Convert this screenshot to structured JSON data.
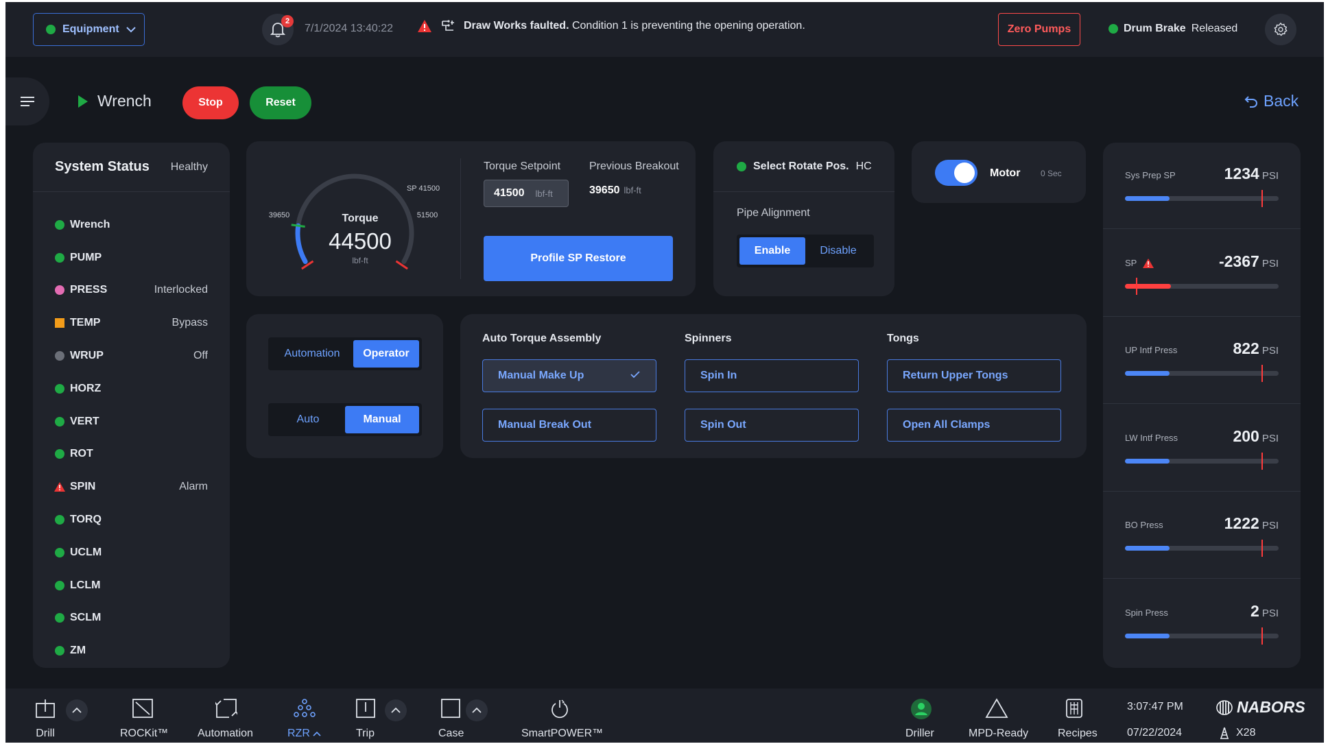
{
  "topbar": {
    "equipment_label": "Equipment",
    "notifications_count": "2",
    "datetime": "7/1/2024  13:40:22",
    "fault_bold": "Draw Works faulted.",
    "fault_text": "Condition 1 is preventing the opening operation.",
    "zero_pumps": "Zero Pumps",
    "drum_brake_label": "Drum Brake",
    "drum_brake_state": "Released"
  },
  "header": {
    "title": "Wrench",
    "stop": "Stop",
    "reset": "Reset",
    "back": "Back"
  },
  "system_status": {
    "title": "System Status",
    "health": "Healthy",
    "items": [
      {
        "name": "Wrench",
        "status": "",
        "indicator": "green"
      },
      {
        "name": "PUMP",
        "status": "",
        "indicator": "green"
      },
      {
        "name": "PRESS",
        "status": "Interlocked",
        "indicator": "pink"
      },
      {
        "name": "TEMP",
        "status": "Bypass",
        "indicator": "orange"
      },
      {
        "name": "WRUP",
        "status": "Off",
        "indicator": "gray"
      },
      {
        "name": "HORZ",
        "status": "",
        "indicator": "green"
      },
      {
        "name": "VERT",
        "status": "",
        "indicator": "green"
      },
      {
        "name": "ROT",
        "status": "",
        "indicator": "green"
      },
      {
        "name": "SPIN",
        "status": "Alarm",
        "indicator": "alarm"
      },
      {
        "name": "TORQ",
        "status": "",
        "indicator": "green"
      },
      {
        "name": "UCLM",
        "status": "",
        "indicator": "green"
      },
      {
        "name": "LCLM",
        "status": "",
        "indicator": "green"
      },
      {
        "name": "SCLM",
        "status": "",
        "indicator": "green"
      },
      {
        "name": "ZM",
        "status": "",
        "indicator": "green"
      }
    ]
  },
  "torque": {
    "label": "Torque",
    "value": "44500",
    "unit": "lbf-ft",
    "gauge_min_label": "39650",
    "gauge_max_label": "51500",
    "gauge_sp_label": "SP 41500",
    "gauge_min": 39650,
    "gauge_max": 51500,
    "gauge_value": 44500,
    "setpoint_label": "Torque Setpoint",
    "setpoint_value": "41500",
    "setpoint_unit": "lbf-ft",
    "prev_label": "Previous Breakout",
    "prev_value": "39650",
    "prev_unit": "lbf-ft",
    "profile_button": "Profile SP Restore"
  },
  "rotate": {
    "select_label": "Select Rotate Pos.",
    "select_value": "HC",
    "pipe_label": "Pipe Alignment",
    "enable": "Enable",
    "disable": "Disable"
  },
  "motor": {
    "label": "Motor",
    "seconds": "0 Sec",
    "on": true
  },
  "mode": {
    "automation": "Automation",
    "operator": "Operator",
    "auto": "Auto",
    "manual": "Manual"
  },
  "auto_torque": {
    "col1_title": "Auto Torque Assembly",
    "col2_title": "Spinners",
    "col3_title": "Tongs",
    "manual_make_up": "Manual Make Up",
    "manual_break_out": "Manual Break Out",
    "spin_in": "Spin In",
    "spin_out": "Spin Out",
    "return_upper_tongs": "Return Upper Tongs",
    "open_all_clamps": "Open All Clamps"
  },
  "pressures": [
    {
      "label": "Sys Prep SP",
      "value": "1234",
      "unit": "PSI",
      "fill": 0.29,
      "mark": 0.89,
      "alarm": false
    },
    {
      "label": "SP",
      "value": "-2367",
      "unit": "PSI",
      "fill": 0.3,
      "mark": 0.07,
      "alarm": true
    },
    {
      "label": "UP Intf Press",
      "value": "822",
      "unit": "PSI",
      "fill": 0.29,
      "mark": 0.89,
      "alarm": false
    },
    {
      "label": "LW Intf Press",
      "value": "200",
      "unit": "PSI",
      "fill": 0.29,
      "mark": 0.89,
      "alarm": false
    },
    {
      "label": "BO Press",
      "value": "1222",
      "unit": "PSI",
      "fill": 0.29,
      "mark": 0.89,
      "alarm": false
    },
    {
      "label": "Spin Press",
      "value": "2",
      "unit": "PSI",
      "fill": 0.29,
      "mark": 0.89,
      "alarm": false
    }
  ],
  "bottom_nav": {
    "drill": "Drill",
    "rockit": "ROCKit™",
    "automation": "Automation",
    "rzr": "RZR",
    "trip": "Trip",
    "case": "Case",
    "smartpower": "SmartPOWER™",
    "driller": "Driller",
    "mpd_ready": "MPD-Ready",
    "recipes": "Recipes",
    "time": "3:07:47 PM",
    "date": "07/22/2024",
    "brand": "NABORS",
    "rig": "X28"
  },
  "colors": {
    "accent": "#3d7bf4",
    "ok": "#1faa45",
    "alarm": "#ec3434",
    "panel": "#20232b",
    "background": "#15181e"
  }
}
